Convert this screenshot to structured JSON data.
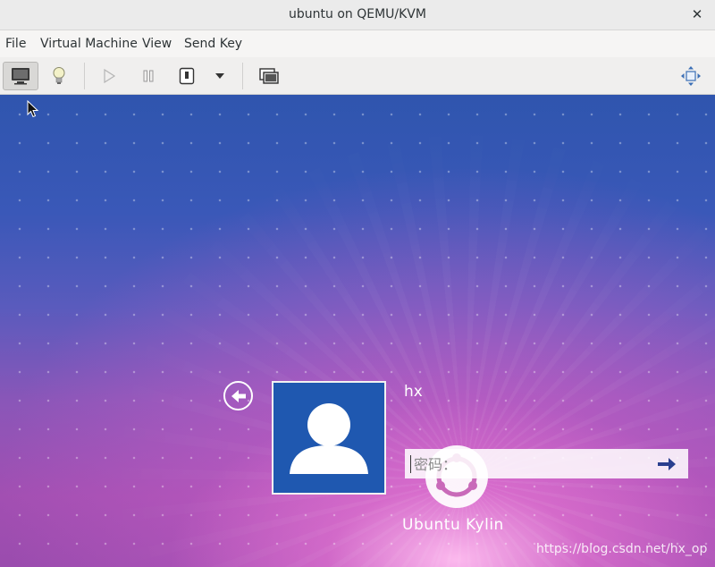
{
  "window": {
    "title": "ubuntu on QEMU/KVM",
    "close_glyph": "✕"
  },
  "menu": {
    "items": [
      "File",
      "Virtual Machine",
      "View",
      "Send Key"
    ]
  },
  "toolbar": {
    "icons": [
      "console-icon",
      "details-lightbulb-icon",
      "run-icon",
      "pause-icon",
      "shutdown-icon",
      "shutdown-menu-icon",
      "snapshot-icon",
      "fullscreen-icon"
    ]
  },
  "login": {
    "username": "hx",
    "password_placeholder": "密码：",
    "brand": "Ubuntu Kylin"
  },
  "watermark": "https://blog.csdn.net/hx_op",
  "colors": {
    "avatar_bg": "#1f58b0",
    "wallpaper_top": "#2f55ae",
    "wallpaper_bottom": "#a24fb2"
  }
}
